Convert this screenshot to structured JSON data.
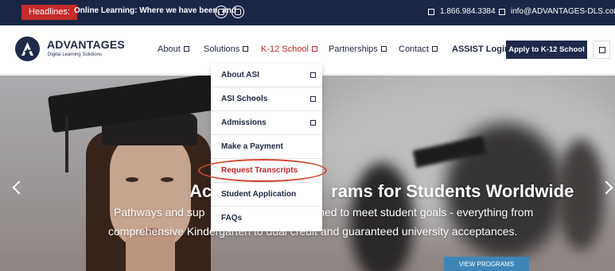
{
  "top_bar": {
    "headlines_label": "Headlines:",
    "headline_text": "Online Learning: Where we have been, and",
    "phone": "1.866.984.3384",
    "email": "info@ADVANTAGES-DLS.com",
    "icons": [
      "prev-headline-icon",
      "next-headline-icon",
      "phone-icon",
      "mail-icon"
    ]
  },
  "header": {
    "logo_name": "ADVANTAGES",
    "logo_tagline": "Digital Learning Solutions",
    "nav": [
      {
        "label": "About"
      },
      {
        "label": "Solutions"
      },
      {
        "label": "K-12 School",
        "active": true
      },
      {
        "label": "Partnerships"
      },
      {
        "label": "Contact"
      },
      {
        "label": "ASSIST Login"
      }
    ],
    "apply_label": "Apply to K-12 School",
    "search_icon": "search-icon"
  },
  "dropdown": {
    "items": [
      {
        "label": "About ASI",
        "has_submenu": true
      },
      {
        "label": "ASI Schools",
        "has_submenu": true
      },
      {
        "label": "Admissions",
        "has_submenu": true
      },
      {
        "label": "Make a Payment",
        "has_submenu": false
      },
      {
        "label": "Request Transcripts",
        "has_submenu": false,
        "highlighted": true
      },
      {
        "label": "Student Application",
        "has_submenu": false
      },
      {
        "label": "FAQs",
        "has_submenu": false
      }
    ]
  },
  "hero": {
    "title_left": "Ac",
    "title_right": "rams for Students Worldwide",
    "subtitle_line1_left": "Pathways and sup",
    "subtitle_line1_right": "gned to meet student goals - everything from",
    "subtitle_line2_left": "comprehensive Kin",
    "subtitle_line2_mid": "dergarten to dual",
    "subtitle_line2_right": "credit and guaranteed university acceptances.",
    "cta_label": "VIEW PROGRAMS"
  },
  "colors": {
    "navy": "#1b2645",
    "badge_red": "#c62a2a",
    "active_red": "#c0262d",
    "highlight_ring": "#d0472e",
    "cta_blue": "#3f86b8"
  }
}
